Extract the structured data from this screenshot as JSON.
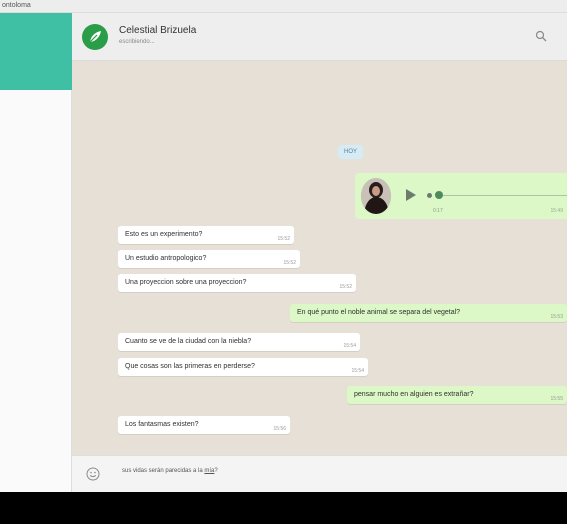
{
  "window": {
    "title": "ontoloma"
  },
  "header": {
    "contact_name": "Celestial Brizuela",
    "contact_status": "escribiendo..."
  },
  "chat": {
    "date_badge": "HOY",
    "audio": {
      "duration": "0:17",
      "time": "15:49"
    },
    "messages": [
      {
        "text": "Esto es un experimento?",
        "time": "15:52"
      },
      {
        "text": "Un estudio antropologico?",
        "time": "15:52"
      },
      {
        "text": "Una proyeccion sobre una proyeccion?",
        "time": "15:52"
      },
      {
        "text": "En qué punto el noble animal se separa del vegetal?",
        "time": "15:53"
      },
      {
        "text": "Cuanto se ve de la ciudad con la niebla?",
        "time": "15:54"
      },
      {
        "text": "Que cosas son las primeras en perderse?",
        "time": "15:54"
      },
      {
        "text": "pensar mucho en alguien es extrañar?",
        "time": "15:55"
      },
      {
        "text": "Los fantasmas existen?",
        "time": "15:56"
      }
    ]
  },
  "input": {
    "text_prefix": "sus vidas serán parecidas a la ",
    "text_link": "mía",
    "text_suffix": "?"
  },
  "colors": {
    "accent": "#3fbfa3",
    "incoming_bubble": "#ffffff",
    "outgoing_bubble": "#dcf8c6",
    "chat_background": "#e6e0d6"
  },
  "icons": {
    "avatar": "leaf-icon",
    "search": "search-icon",
    "emoji": "smiley-icon",
    "play": "play-icon"
  }
}
